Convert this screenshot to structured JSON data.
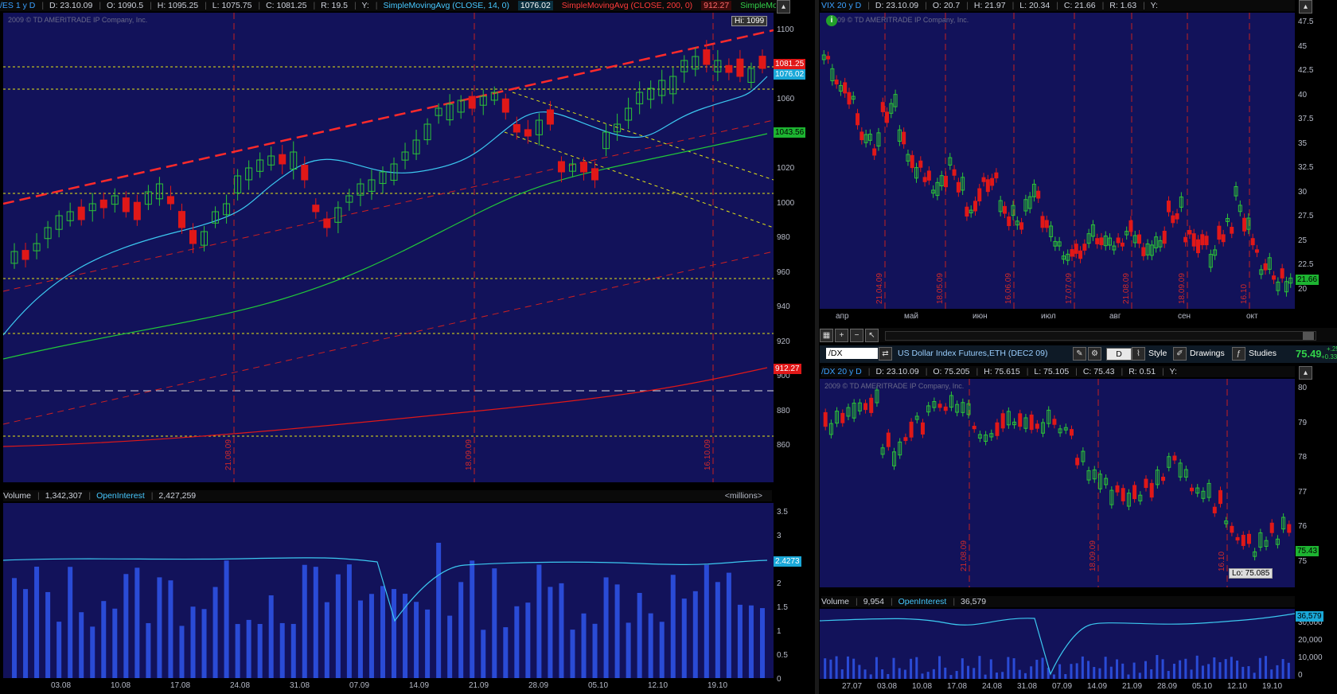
{
  "colors": {
    "bg": "#12125a",
    "up": "#2cc437",
    "down": "#e01818",
    "sma14": "#3cc8f0",
    "sma200": "#e01818",
    "sma50": "#21c83a",
    "grid_v": "#c42020",
    "level": "#e6e614"
  },
  "es": {
    "header": {
      "symbol": "/ES 1 y D",
      "date": "D: 23.10.09",
      "open": "O: 1090.5",
      "high": "H: 1095.25",
      "low": "L: 1075.75",
      "close": "C: 1081.25",
      "range": "R: 19.5",
      "y": "Y:",
      "sma1_label": "SimpleMovingAvg (CLOSE, 14, 0)",
      "sma1_val": "1076.02",
      "sma2_label": "SimpleMovingAvg (CLOSE, 200, 0)",
      "sma2_val": "912.27",
      "sma3_label": "SimpleMovingAvg (C..."
    },
    "copyright": "2009 © TD AMERITRADE IP Company, Inc.",
    "hi_label": "Hi: 1099",
    "flags": [
      "1081.25",
      "1076.02",
      "1043.56",
      "912.27"
    ],
    "y_ticks": [
      "1100",
      "1080",
      "1060",
      "1040",
      "1020",
      "1000",
      "980",
      "960",
      "940",
      "920",
      "900",
      "880",
      "860"
    ],
    "date_markers": [
      "21.08.09",
      "18.09.09",
      "16.10.09"
    ],
    "volume_header": {
      "volume_label": "Volume",
      "volume_val": "1,342,307",
      "oi_label": "OpenInterest",
      "oi_val": "2,427,259",
      "units": "<millions>"
    },
    "vol_ticks": [
      "3.5",
      "3",
      "2.5",
      "2",
      "1.5",
      "1",
      "0.5",
      "0"
    ],
    "vol_flag": "2.4273",
    "x_ticks": [
      "03.08",
      "10.08",
      "17.08",
      "24.08",
      "31.08",
      "07.09",
      "14.09",
      "21.09",
      "28.09",
      "05.10",
      "12.10",
      "19.10"
    ]
  },
  "vix": {
    "header": {
      "symbol": "VIX 20 y D",
      "date": "D: 23.10.09",
      "open": "O: 20.7",
      "high": "H: 21.97",
      "low": "L: 20.34",
      "close": "C: 21.66",
      "range": "R: 1.63",
      "y": "Y:"
    },
    "copyright": "2009 © TD AMERITRADE IP Company, Inc.",
    "flag": "21.66",
    "y_ticks": [
      "47.5",
      "45",
      "42.5",
      "40",
      "37.5",
      "35",
      "32.5",
      "30",
      "27.5",
      "25",
      "22.5",
      "20"
    ],
    "date_markers": [
      "21.04.09",
      "18.05.09",
      "16.06.09",
      "17.07.09",
      "21.08.09",
      "18.09.09",
      "16.10"
    ],
    "x_ticks": [
      "апр",
      "май",
      "июн",
      "июл",
      "авг",
      "сен",
      "окт"
    ]
  },
  "dx_toolbar": {
    "symbol_input": "/DX",
    "description": "US Dollar Index Futures,ETH (DEC2 09)",
    "period_button": "D",
    "style_button": "Style",
    "drawings_button": "Drawings",
    "studies_button": "Studies",
    "last_price": "75.49",
    "change": "+.25",
    "change_pct": "+0.33%"
  },
  "dx": {
    "header": {
      "symbol": "/DX 20 y D",
      "date": "D: 23.10.09",
      "open": "O: 75.205",
      "high": "H: 75.615",
      "low": "L: 75.105",
      "close": "C: 75.43",
      "range": "R: 0.51",
      "y": "Y:"
    },
    "copyright": "2009 © TD AMERITRADE IP Company, Inc.",
    "flag": "75.43",
    "lo_label": "Lo: 75.085",
    "y_ticks": [
      "80",
      "79",
      "78",
      "77",
      "76",
      "75"
    ],
    "date_markers": [
      "21.08.09",
      "18.09.09",
      "16.10"
    ],
    "volume_header": {
      "volume_label": "Volume",
      "volume_val": "9,954",
      "oi_label": "OpenInterest",
      "oi_val": "36,579"
    },
    "vol_ticks": [
      "30,000",
      "20,000",
      "10,000",
      "0"
    ],
    "vol_flag": "36,579",
    "x_ticks": [
      "27.07",
      "03.08",
      "10.08",
      "17.08",
      "24.08",
      "31.08",
      "07.09",
      "14.09",
      "21.09",
      "28.09",
      "05.10",
      "12.10",
      "19.10"
    ]
  }
}
